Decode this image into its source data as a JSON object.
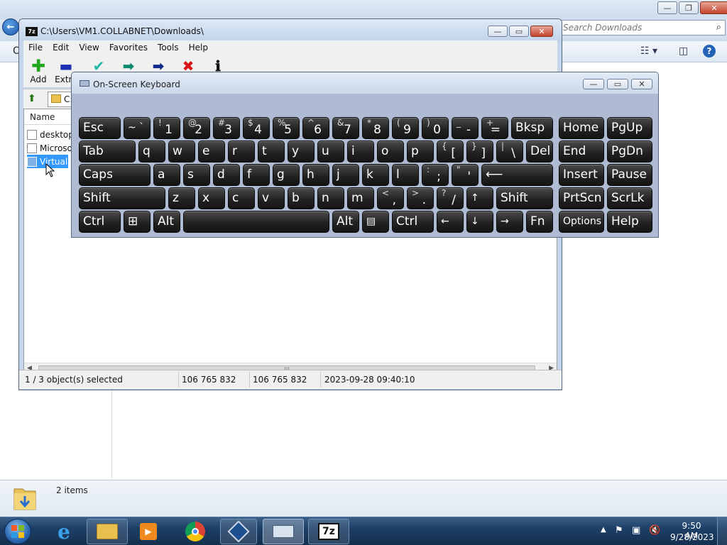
{
  "explorer": {
    "search_placeholder": "Search Downloads",
    "details_count": "2 items",
    "sidebar_partial_label": "O"
  },
  "sevenzip": {
    "title": "C:\\Users\\VM1.COLLABNET\\Downloads\\",
    "menu": [
      "File",
      "Edit",
      "View",
      "Favorites",
      "Tools",
      "Help"
    ],
    "toolbar": [
      {
        "label": "Add",
        "icon": "plus-icon",
        "color": "#22a51f"
      },
      {
        "label": "Extract",
        "icon": "minus-icon",
        "color": "#1c2fb5"
      },
      {
        "label": "Test",
        "icon": "check-icon",
        "color": "#1fb7a8"
      },
      {
        "label": "Copy",
        "icon": "copy-arrow-icon",
        "color": "#0f8a6e"
      },
      {
        "label": "Move",
        "icon": "move-arrow-icon",
        "color": "#0f2a8a"
      },
      {
        "label": "Delete",
        "icon": "delete-icon",
        "color": "#d81414"
      },
      {
        "label": "Info",
        "icon": "info-icon",
        "color": "#111111"
      }
    ],
    "toolbar_visible_labels": {
      "add": "Add",
      "extract": "Extra"
    },
    "address": "C:",
    "column_header": "Name",
    "files": [
      {
        "name": "desktop",
        "selected": false
      },
      {
        "name": "Microso",
        "selected": false
      },
      {
        "name": "VirtualB",
        "selected": true
      }
    ],
    "status": {
      "selection": "1 / 3 object(s) selected",
      "size": "106 765 832",
      "packed_size": "106 765 832",
      "modified": "2023-09-28 09:40:10"
    }
  },
  "osk": {
    "title": "On-Screen Keyboard",
    "keys": {
      "esc": "Esc",
      "tilde_top": "~ `",
      "k1_top": "!",
      "k1": "1",
      "k2_top": "@",
      "k2": "2",
      "k3_top": "#",
      "k3": "3",
      "k4_top": "$",
      "k4": "4",
      "k5_top": "%",
      "k5": "5",
      "k6_top": "^",
      "k6": "6",
      "k7_top": "&",
      "k7": "7",
      "k8_top": "*",
      "k8": "8",
      "k9_top": "(",
      "k9": "9",
      "k0_top": ")",
      "k0": "0",
      "minus_top": "_",
      "minus": "-",
      "equal_top": "+",
      "equal": "=",
      "bksp": "Bksp",
      "tab": "Tab",
      "q": "q",
      "w": "w",
      "e": "e",
      "r": "r",
      "t": "t",
      "y": "y",
      "u": "u",
      "i": "i",
      "o": "o",
      "p": "p",
      "lbracket_top": "{",
      "lbracket": "[",
      "rbracket_top": "}",
      "rbracket": "]",
      "bslash_top": "|",
      "bslash": "\\",
      "del": "Del",
      "caps": "Caps",
      "a": "a",
      "s": "s",
      "d": "d",
      "f": "f",
      "g": "g",
      "h": "h",
      "j": "j",
      "k": "k",
      "l": "l",
      "semicolon_top": ":",
      "semicolon": ";",
      "quote_top": "\"",
      "quote": "'",
      "enter": "⟵",
      "shift_left": "Shift",
      "z": "z",
      "x": "x",
      "c": "c",
      "v": "v",
      "b": "b",
      "n": "n",
      "m": "m",
      "comma_top": "<",
      "comma": ",",
      "period_top": ">",
      "period": ".",
      "slash_top": "?",
      "slash": "/",
      "up": "↑",
      "shift_right": "Shift",
      "ctrl_left": "Ctrl",
      "win": "⊞",
      "alt_left": "Alt",
      "space": "",
      "alt_right": "Alt",
      "menu": "▤",
      "ctrl_right": "Ctrl",
      "left": "←",
      "down": "↓",
      "right": "→",
      "fn": "Fn",
      "home": "Home",
      "pgup": "PgUp",
      "end": "End",
      "pgdn": "PgDn",
      "insert": "Insert",
      "pause": "Pause",
      "prtscn": "PrtScn",
      "scrlk": "ScrLk",
      "options": "Options",
      "help": "Help"
    }
  },
  "taskbar": {
    "time": "9:50 AM",
    "date": "9/28/2023",
    "apps": [
      "start",
      "internet-explorer",
      "windows-explorer",
      "media-player",
      "chrome",
      "virtualbox",
      "on-screen-keyboard",
      "7-zip"
    ],
    "sevenzip_badge": "7z"
  },
  "colors": {
    "taskbar_bg": "#1d3f66",
    "selection": "#3399ff",
    "key_bg": "#222222"
  }
}
